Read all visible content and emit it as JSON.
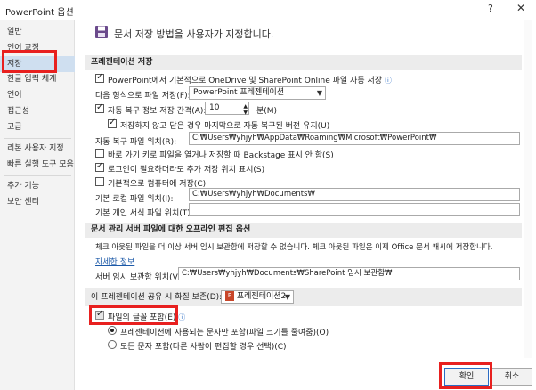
{
  "window": {
    "title": "PowerPoint 옵션",
    "help": "?",
    "close": "✕"
  },
  "sidebar": {
    "items": [
      {
        "label": "일반"
      },
      {
        "label": "언어 교정"
      },
      {
        "label": "저장"
      },
      {
        "label": "한글 입력 체계"
      },
      {
        "label": "언어"
      },
      {
        "label": "접근성"
      },
      {
        "label": "고급"
      },
      {
        "label": "리본 사용자 지정"
      },
      {
        "label": "빠른 실행 도구 모음"
      },
      {
        "label": "추가 기능"
      },
      {
        "label": "보안 센터"
      }
    ],
    "active_index": 2
  },
  "header": {
    "text": "문서 저장 방법을 사용자가 지정합니다."
  },
  "save_presentations": {
    "section_title": "프레젠테이션 저장",
    "autosave_label": "PowerPoint에서 기본적으로 OneDrive 및 SharePoint Online 파일 자동 저장",
    "autosave_checked": true,
    "format_label": "다음 형식으로 파일 저장(F):",
    "format_value": "PowerPoint 프레젠테이션",
    "autorecover_label": "자동 복구 정보 저장 간격(A):",
    "autorecover_checked": true,
    "autorecover_value": "10",
    "autorecover_unit": "분(M)",
    "keep_last_label": "저장하지 않고 닫은 경우 마지막으로 자동 복구된 버전 유지(U)",
    "keep_last_checked": true,
    "recover_location_label": "자동 복구 파일 위치(R):",
    "recover_location_value": "C:₩Users₩yhjyh₩AppData₩Roaming₩Microsoft₩PowerPoint₩",
    "backstage_label": "바로 가기 키로 파일을 열거나 저장할 때 Backstage 표시 안 함(S)",
    "backstage_checked": false,
    "more_locations_label": "로그인이 필요하더라도 추가 저장 위치 표시(S)",
    "more_locations_checked": true,
    "default_computer_label": "기본적으로 컴퓨터에 저장(C)",
    "default_computer_checked": false,
    "local_location_label": "기본 로컬 파일 위치(I):",
    "local_location_value": "C:₩Users₩yhjyh₩Documents₩",
    "template_location_label": "기본 개인 서식 파일 위치(T):",
    "template_location_value": ""
  },
  "offline_editing": {
    "section_title": "문서 관리 서버 파일에 대한 오프라인 편집 옵션",
    "description": "체크 아웃된 파일을 더 이상 서버 임시 보관함에 저장할 수 없습니다. 체크 아웃된 파일은 이제 Office 문서 캐시에 저장합니다.",
    "learn_more": "자세한 정보",
    "drafts_label": "서버 임시 보관함 위치(V):",
    "drafts_value": "C:₩Users₩yhjyh₩Documents₩SharePoint 임시 보관함₩"
  },
  "fidelity": {
    "label": "이 프레젠테이션 공유 시 화질 보존(D):",
    "presentation_value": "프레젠테이션2",
    "embed_fonts_label": "파일의 글꼴 포함(E)",
    "embed_fonts_checked": true,
    "embed_info": "ⓘ",
    "option_used_label": "프레젠테이션에 사용되는 문자만 포함(파일 크기를 줄여줌)(O)",
    "option_used_checked": true,
    "option_all_label": "모든 문자 포함(다른 사람이 편집할 경우 선택)(C)",
    "option_all_checked": false
  },
  "footer": {
    "ok_label": "확인",
    "cancel_label": "취소"
  },
  "colors": {
    "highlight": "#e8201f",
    "active_sidebar": "#cfdff0",
    "section_bg": "#ececec",
    "link": "#1d5aa8"
  }
}
